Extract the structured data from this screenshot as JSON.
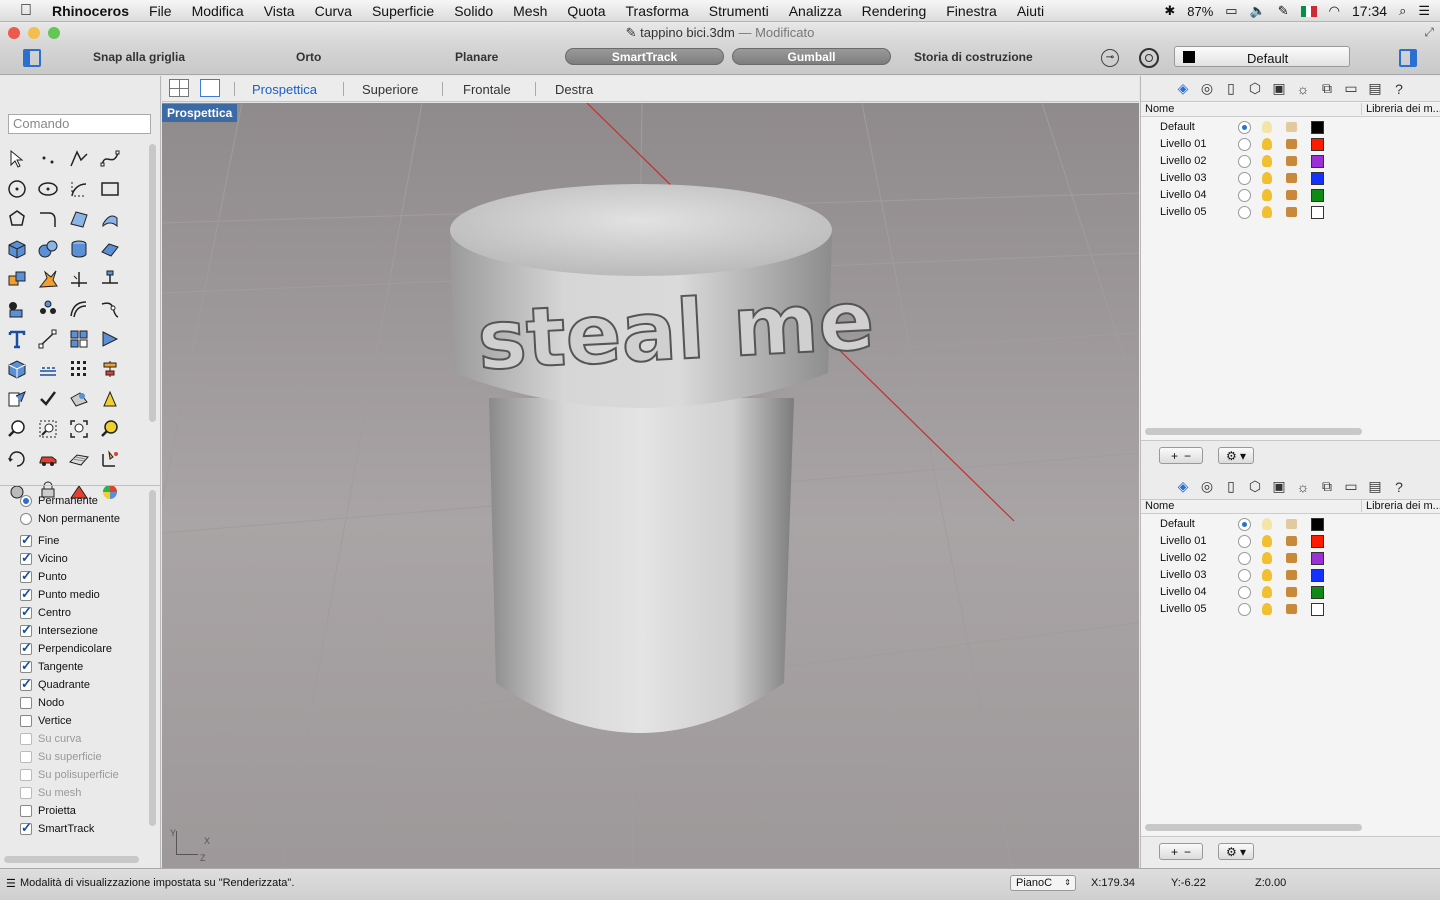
{
  "menubar": {
    "app_name": "Rhinoceros",
    "items": [
      "File",
      "Modifica",
      "Vista",
      "Curva",
      "Superficie",
      "Solido",
      "Mesh",
      "Quota",
      "Trasforma",
      "Strumenti",
      "Analizza",
      "Rendering",
      "Finestra",
      "Aiuti"
    ],
    "battery": "87%",
    "clock": "17:34"
  },
  "window": {
    "title": "tappino bici.3dm",
    "separator": "—",
    "status": "Modificato"
  },
  "toolbar": {
    "snap_grid": "Snap alla griglia",
    "ortho": "Orto",
    "planar": "Planare",
    "smarttrack": "SmartTrack",
    "gumball": "Gumball",
    "history": "Storia di costruzione",
    "layer": "Default"
  },
  "viewport_tabs": [
    "Prospettica",
    "Superiore",
    "Frontale",
    "Destra"
  ],
  "viewport": {
    "label": "Prospettica",
    "model_text": "steal me",
    "axis_y": "Y",
    "axis_x": "X",
    "axis_z": "Z"
  },
  "command": {
    "placeholder": "Comando"
  },
  "osnap": {
    "modes": [
      {
        "label": "Permanente",
        "state": "selected"
      },
      {
        "label": "Non permanente",
        "state": "unselected"
      }
    ],
    "items": [
      {
        "label": "Fine",
        "checked": true
      },
      {
        "label": "Vicino",
        "checked": true
      },
      {
        "label": "Punto",
        "checked": true
      },
      {
        "label": "Punto medio",
        "checked": true
      },
      {
        "label": "Centro",
        "checked": true
      },
      {
        "label": "Intersezione",
        "checked": true
      },
      {
        "label": "Perpendicolare",
        "checked": true
      },
      {
        "label": "Tangente",
        "checked": true
      },
      {
        "label": "Quadrante",
        "checked": true
      },
      {
        "label": "Nodo",
        "checked": false
      },
      {
        "label": "Vertice",
        "checked": false
      },
      {
        "label": "Su curva",
        "checked": false,
        "disabled": true
      },
      {
        "label": "Su superficie",
        "checked": false,
        "disabled": true
      },
      {
        "label": "Su polisuperficie",
        "checked": false,
        "disabled": true
      },
      {
        "label": "Su mesh",
        "checked": false,
        "disabled": true
      },
      {
        "label": "Proietta",
        "checked": false
      },
      {
        "label": "SmartTrack",
        "checked": true
      }
    ]
  },
  "layers_panel": {
    "col_name": "Nome",
    "col_library": "Libreria dei m...",
    "add": "+",
    "remove": "−",
    "gear": "⚙ ▾",
    "rows": [
      {
        "name": "Default",
        "current": true,
        "color": "#000000"
      },
      {
        "name": "Livello 01",
        "current": false,
        "color": "#ff1a00"
      },
      {
        "name": "Livello 02",
        "current": false,
        "color": "#9b30d8"
      },
      {
        "name": "Livello 03",
        "current": false,
        "color": "#1432ff"
      },
      {
        "name": "Livello 04",
        "current": false,
        "color": "#0f8a16"
      },
      {
        "name": "Livello 05",
        "current": false,
        "color": "#ffffff"
      }
    ]
  },
  "statusbar": {
    "message": "Modalità di visualizzazione impostata su \"Renderizzata\".",
    "plane": "PianoC",
    "x": "X:179.34",
    "y": "Y:-6.22",
    "z": "Z:0.00"
  }
}
